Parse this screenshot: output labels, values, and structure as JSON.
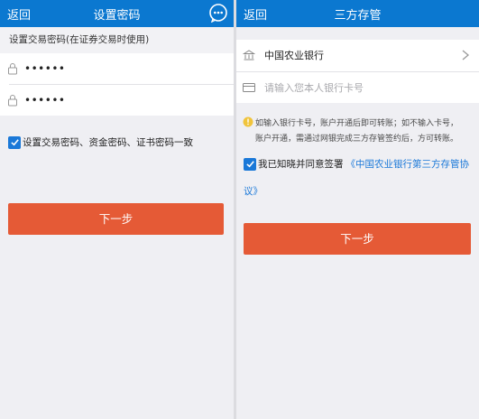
{
  "left_screen": {
    "back_label": "返回",
    "title": "设置密码",
    "section_label": "设置交易密码(在证券交易时使用)",
    "password_1": "••••••",
    "password_2": "••••••",
    "checkbox_label": "设置交易密码、资金密码、证书密码一致",
    "next_button": "下一步"
  },
  "right_screen": {
    "back_label": "返回",
    "title": "三方存管",
    "bank_name": "中国农业银行",
    "card_placeholder": "请输入您本人银行卡号",
    "info_line_1": "如输入银行卡号，账户开通后即可转账；如不输入卡号，",
    "info_line_2": "账户开通，需通过网银完成三方存管签约后，方可转账。",
    "agreement_prefix": "我已知晓并同意签署",
    "agreement_link_part1": "《中国农业银行第三方存管协",
    "agreement_link_part2": "议》",
    "next_button": "下一步"
  },
  "colors": {
    "header_blue": "#0b78d0",
    "button_orange": "#e55a36",
    "checkbox_blue": "#1a78d8",
    "link_blue": "#1a78d8",
    "info_yellow": "#f0c43c"
  }
}
